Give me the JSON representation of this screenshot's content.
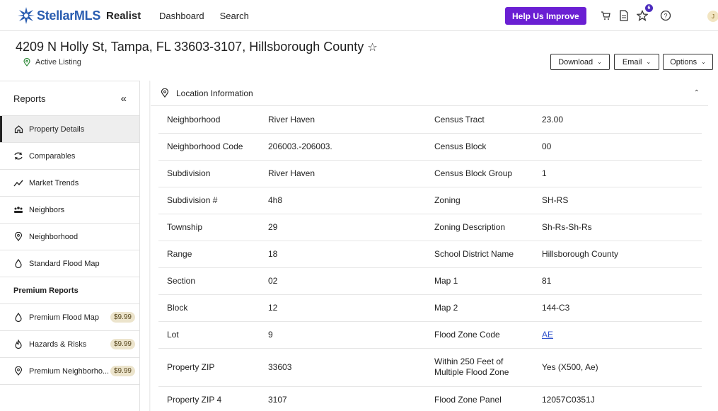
{
  "header": {
    "brand": "StellarMLS",
    "product": "Realist",
    "nav": [
      "Dashboard",
      "Search"
    ],
    "help_label": "Help Us Improve",
    "favorites_count": "6",
    "avatar_initial": "J"
  },
  "listing": {
    "address": "4209 N Holly St, Tampa, FL 33603-3107, Hillsborough County",
    "status": "Active Listing"
  },
  "actions": {
    "download": "Download",
    "email": "Email",
    "options": "Options"
  },
  "sidebar": {
    "title": "Reports",
    "collapse_glyph": "«",
    "items": [
      {
        "label": "Property Details",
        "icon": "home-icon"
      },
      {
        "label": "Comparables",
        "icon": "refresh-icon"
      },
      {
        "label": "Market Trends",
        "icon": "trend-icon"
      },
      {
        "label": "Neighbors",
        "icon": "people-icon"
      },
      {
        "label": "Neighborhood",
        "icon": "location-pin-icon"
      },
      {
        "label": "Standard Flood Map",
        "icon": "droplet-icon"
      }
    ],
    "premium_title": "Premium Reports",
    "premium_items": [
      {
        "label": "Premium Flood Map",
        "price": "$9.99",
        "icon": "droplet-icon"
      },
      {
        "label": "Hazards & Risks",
        "price": "$9.99",
        "icon": "fire-icon"
      },
      {
        "label": "Premium Neighborho...",
        "price": "$9.99",
        "icon": "location-pin-icon"
      }
    ]
  },
  "location": {
    "title": "Location Information",
    "rows": [
      {
        "l1": "Neighborhood",
        "v1": "River Haven",
        "l2": "Census Tract",
        "v2": "23.00"
      },
      {
        "l1": "Neighborhood Code",
        "v1": "206003.-206003.",
        "l2": "Census Block",
        "v2": "00"
      },
      {
        "l1": "Subdivision",
        "v1": "River Haven",
        "l2": "Census Block Group",
        "v2": "1"
      },
      {
        "l1": "Subdivision #",
        "v1": "4h8",
        "l2": "Zoning",
        "v2": "SH-RS"
      },
      {
        "l1": "Township",
        "v1": "29",
        "l2": "Zoning Description",
        "v2": "Sh-Rs-Sh-Rs"
      },
      {
        "l1": "Range",
        "v1": "18",
        "l2": "School District Name",
        "v2": "Hillsborough County"
      },
      {
        "l1": "Section",
        "v1": "02",
        "l2": "Map 1",
        "v2": "81"
      },
      {
        "l1": "Block",
        "v1": "12",
        "l2": "Map 2",
        "v2": "144-C3"
      },
      {
        "l1": "Lot",
        "v1": "9",
        "l2": "Flood Zone Code",
        "v2": "AE"
      },
      {
        "l1": "Property ZIP",
        "v1": "33603",
        "l2": "Within 250 Feet of Multiple Flood Zone",
        "v2": "Yes (X500, Ae)"
      },
      {
        "l1": "Property ZIP 4",
        "v1": "3107",
        "l2": "Flood Zone Panel",
        "v2": "12057C0351J"
      }
    ]
  }
}
